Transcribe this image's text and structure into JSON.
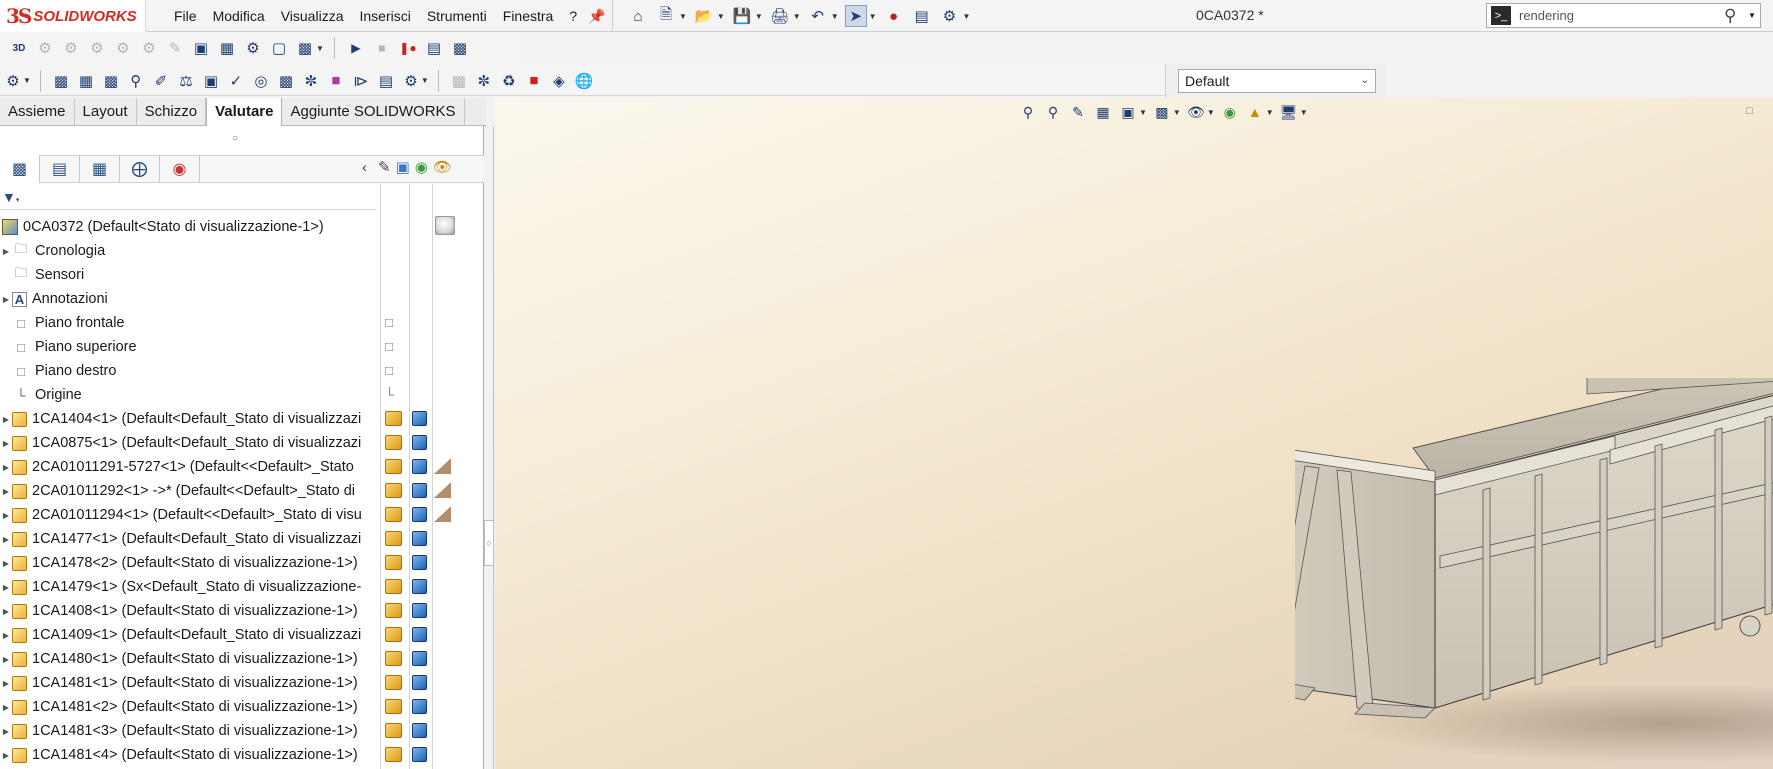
{
  "titlebar": {
    "brand_ds": "3S",
    "brand_name": "SOLIDWORKS",
    "menu": [
      "File",
      "Modifica",
      "Visualizza",
      "Inserisci",
      "Strumenti",
      "Finestra",
      "?"
    ],
    "document_title": "0CA0372 *",
    "search": {
      "value": "rendering",
      "icons": [
        "command-icon",
        "search-icon"
      ]
    }
  },
  "config_select": {
    "value": "Default"
  },
  "tabs": [
    "Assieme",
    "Layout",
    "Schizzo",
    "Valutare",
    "Aggiunte SOLIDWORKS"
  ],
  "active_tab": "Valutare",
  "tree": {
    "root": "0CA0372  (Default<Stato di visualizzazione-1>)",
    "items": [
      {
        "label": "Cronologia",
        "icon": "folder-icon",
        "expandable": true
      },
      {
        "label": "Sensori",
        "icon": "sensor-folder-icon",
        "expandable": false
      },
      {
        "label": "Annotazioni",
        "icon": "annotation-icon",
        "expandable": true
      },
      {
        "label": "Piano frontale",
        "icon": "plane-icon",
        "expandable": false
      },
      {
        "label": "Piano superiore",
        "icon": "plane-icon",
        "expandable": false
      },
      {
        "label": "Piano destro",
        "icon": "plane-icon",
        "expandable": false
      },
      {
        "label": "Origine",
        "icon": "origin-icon",
        "expandable": false
      },
      {
        "label": "1CA1404<1> (Default<Default_Stato di visualizzazi",
        "icon": "subassembly-icon",
        "expandable": true
      },
      {
        "label": "1CA0875<1> (Default<Default_Stato di visualizzazi",
        "icon": "subassembly-icon",
        "expandable": true
      },
      {
        "label": "2CA01011291-5727<1> (Default<<Default>_Stato",
        "icon": "subassembly-icon",
        "expandable": true
      },
      {
        "label": "2CA01011292<1> ->* (Default<<Default>_Stato di",
        "icon": "subassembly-icon",
        "expandable": true
      },
      {
        "label": "2CA01011294<1> (Default<<Default>_Stato di visu",
        "icon": "subassembly-icon",
        "expandable": true
      },
      {
        "label": "1CA1477<1> (Default<Default_Stato di visualizzazi",
        "icon": "subassembly-icon",
        "expandable": true
      },
      {
        "label": "1CA1478<2> (Default<Stato di visualizzazione-1>)",
        "icon": "subassembly-icon",
        "expandable": true
      },
      {
        "label": "1CA1479<1> (Sx<Default_Stato di visualizzazione-",
        "icon": "subassembly-icon",
        "expandable": true
      },
      {
        "label": "1CA1408<1> (Default<Stato di visualizzazione-1>)",
        "icon": "subassembly-icon",
        "expandable": true
      },
      {
        "label": "1CA1409<1> (Default<Default_Stato di visualizzazi",
        "icon": "subassembly-icon",
        "expandable": true
      },
      {
        "label": "1CA1480<1> (Default<Stato di visualizzazione-1>)",
        "icon": "subassembly-icon",
        "expandable": true
      },
      {
        "label": "1CA1481<1> (Default<Stato di visualizzazione-1>)",
        "icon": "subassembly-icon",
        "expandable": true
      },
      {
        "label": "1CA1481<2> (Default<Stato di visualizzazione-1>)",
        "icon": "subassembly-icon",
        "expandable": true
      },
      {
        "label": "1CA1481<3> (Default<Stato di visualizzazione-1>)",
        "icon": "subassembly-icon",
        "expandable": true
      },
      {
        "label": "1CA1481<4> (Default<Stato di visualizzazione-1>)",
        "icon": "subassembly-icon",
        "expandable": true
      }
    ]
  },
  "colors": {
    "brand_red": "#d52b1e",
    "accent_blue": "#1c5fb0",
    "part_yellow": "#e5a21a",
    "viewport_top": "#fbf7ee",
    "viewport_bottom": "#e4d0c0"
  }
}
